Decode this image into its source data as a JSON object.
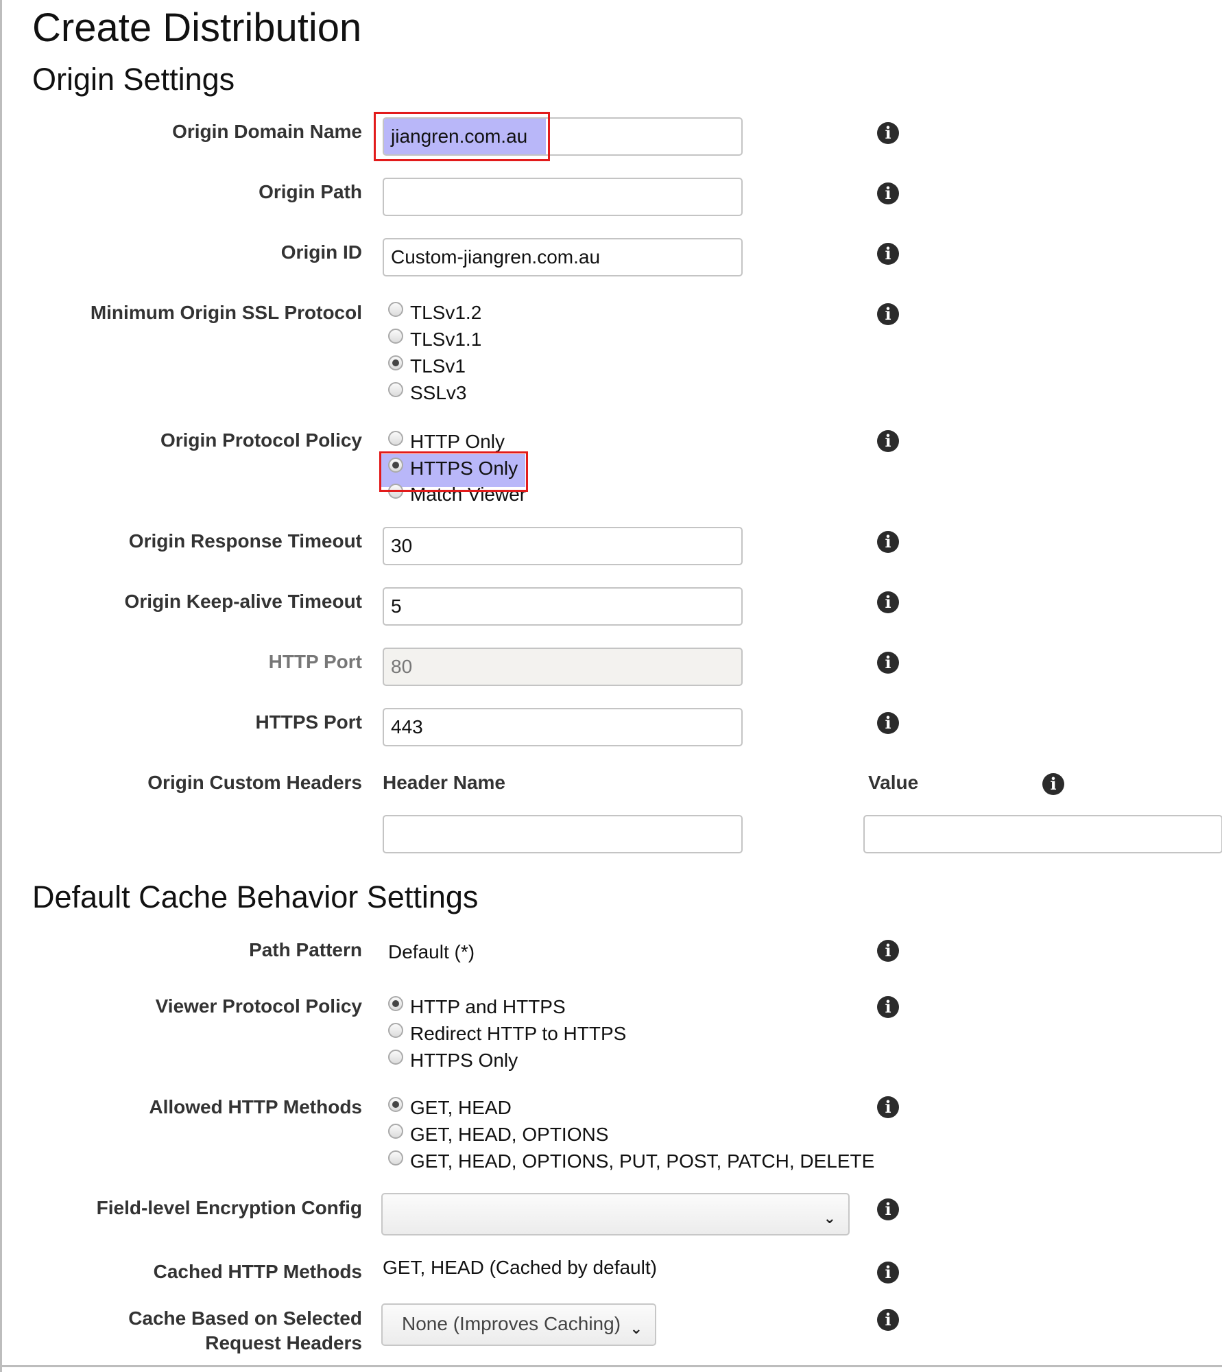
{
  "page": {
    "title": "Create Distribution"
  },
  "origin": {
    "section_title": "Origin Settings",
    "domain_name_label": "Origin Domain Name",
    "domain_name_value": "jiangren.com.au",
    "path_label": "Origin Path",
    "path_value": "",
    "id_label": "Origin ID",
    "id_value": "Custom-jiangren.com.au",
    "ssl_label": "Minimum Origin SSL Protocol",
    "ssl_options": [
      "TLSv1.2",
      "TLSv1.1",
      "TLSv1",
      "SSLv3"
    ],
    "ssl_selected": "TLSv1",
    "protocol_label": "Origin Protocol Policy",
    "protocol_options": [
      "HTTP Only",
      "HTTPS Only",
      "Match Viewer"
    ],
    "protocol_selected": "HTTPS Only",
    "response_timeout_label": "Origin Response Timeout",
    "response_timeout_value": "30",
    "keepalive_label": "Origin Keep-alive Timeout",
    "keepalive_value": "5",
    "http_port_label": "HTTP Port",
    "http_port_value": "80",
    "https_port_label": "HTTPS Port",
    "https_port_value": "443",
    "custom_headers_label": "Origin Custom Headers",
    "header_name_col": "Header Name",
    "value_col": "Value"
  },
  "cache": {
    "section_title": "Default Cache Behavior Settings",
    "path_pattern_label": "Path Pattern",
    "path_pattern_value": "Default (*)",
    "viewer_policy_label": "Viewer Protocol Policy",
    "viewer_policy_options": [
      "HTTP and HTTPS",
      "Redirect HTTP to HTTPS",
      "HTTPS Only"
    ],
    "viewer_policy_selected": "HTTP and HTTPS",
    "allowed_methods_label": "Allowed HTTP Methods",
    "allowed_methods_options": [
      "GET, HEAD",
      "GET, HEAD, OPTIONS",
      "GET, HEAD, OPTIONS, PUT, POST, PATCH, DELETE"
    ],
    "allowed_methods_selected": "GET, HEAD",
    "fle_label": "Field-level Encryption Config",
    "fle_value": "",
    "cached_methods_label": "Cached HTTP Methods",
    "cached_methods_value": "GET, HEAD (Cached by default)",
    "cache_headers_label_line1": "Cache Based on Selected",
    "cache_headers_label_line2": "Request Headers",
    "cache_headers_value": "None (Improves Caching)"
  },
  "icons": {
    "info": "info-icon",
    "info_glyph": "i",
    "dropdown": "chevron-down-icon",
    "dropdown_glyph": "⌄"
  },
  "colors": {
    "highlight_fill": "#b9b7f9",
    "highlight_border": "#e21b1b"
  }
}
